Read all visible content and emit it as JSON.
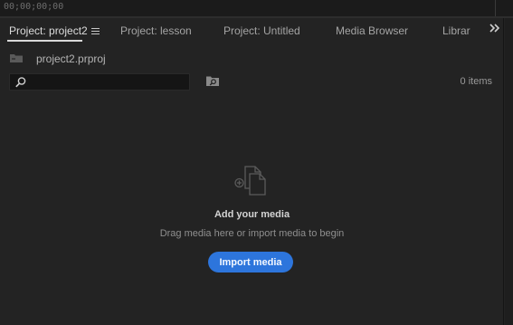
{
  "timecode": "00;00;00;00",
  "tabs": [
    {
      "label": "Project: project2",
      "active": true
    },
    {
      "label": "Project: lesson",
      "active": false
    },
    {
      "label": "Project: Untitled",
      "active": false
    },
    {
      "label": "Media Browser",
      "active": false
    },
    {
      "label": "Libraries",
      "active": false
    }
  ],
  "project": {
    "file_name": "project2.prproj",
    "items_count": "0 items"
  },
  "search": {
    "value": "",
    "placeholder": ""
  },
  "empty_state": {
    "title": "Add your media",
    "subtitle": "Drag media here or import media to begin",
    "button_label": "Import media"
  },
  "icons": {
    "panel_menu": "hamburger-menu-icon",
    "overflow": "double-chevron-right-icon",
    "project_file": "folder-icon",
    "search": "search-icon",
    "find_in_bin": "bin-search-icon",
    "empty_media": "add-media-files-icon"
  },
  "colors": {
    "panel_bg": "#232323",
    "accent": "#2d75dc",
    "active_tab_text": "#dcdcdc"
  }
}
